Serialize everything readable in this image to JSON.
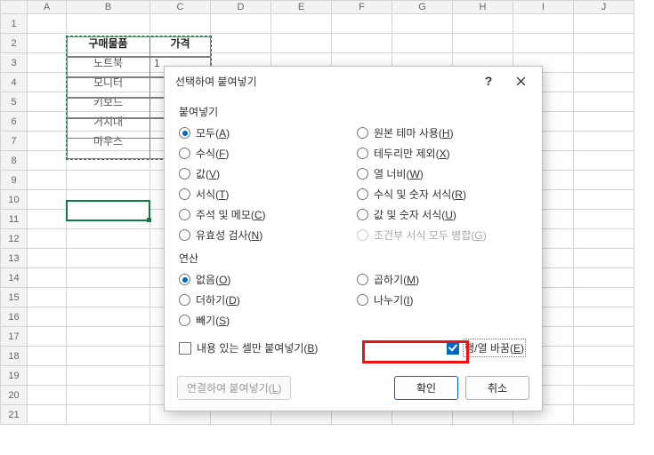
{
  "columns": [
    "A",
    "B",
    "C",
    "D",
    "E",
    "F",
    "G",
    "H",
    "I",
    "J"
  ],
  "rows": [
    "1",
    "2",
    "3",
    "4",
    "5",
    "6",
    "7",
    "8",
    "9",
    "10",
    "11",
    "12",
    "13",
    "14",
    "15",
    "16",
    "17",
    "18",
    "19",
    "20",
    "21"
  ],
  "table": {
    "header_item": "구매물품",
    "header_price": "가격",
    "items": [
      "노트북",
      "모니터",
      "키보드",
      "거치대",
      "마우스"
    ],
    "price_peek": "1"
  },
  "dialog": {
    "title": "선택하여 붙여넣기",
    "group_paste": "붙여넣기",
    "paste_left": [
      {
        "label": "모두",
        "accel": "A",
        "checked": true
      },
      {
        "label": "수식",
        "accel": "F"
      },
      {
        "label": "값",
        "accel": "V"
      },
      {
        "label": "서식",
        "accel": "T"
      },
      {
        "label": "주석 및 메모",
        "accel": "C"
      },
      {
        "label": "유효성 검사",
        "accel": "N"
      }
    ],
    "paste_right": [
      {
        "label": "원본 테마 사용",
        "accel": "H"
      },
      {
        "label": "테두리만 제외",
        "accel": "X"
      },
      {
        "label": "열 너비",
        "accel": "W"
      },
      {
        "label": "수식 및 숫자 서식",
        "accel": "R"
      },
      {
        "label": "값 및 숫자 서식",
        "accel": "U"
      },
      {
        "label": "조건부 서식 모두 병합",
        "accel": "G",
        "disabled": true
      }
    ],
    "group_op": "연산",
    "op_left": [
      {
        "label": "없음",
        "accel": "O",
        "checked": true
      },
      {
        "label": "더하기",
        "accel": "D"
      },
      {
        "label": "빼기",
        "accel": "S"
      }
    ],
    "op_right": [
      {
        "label": "곱하기",
        "accel": "M"
      },
      {
        "label": "나누기",
        "accel": "I"
      }
    ],
    "skip_blanks": {
      "label": "내용 있는 셀만 붙여넣기",
      "accel": "B"
    },
    "transpose": {
      "label": "행/열 바꿈",
      "accel": "E",
      "checked": true
    },
    "paste_link": {
      "label": "연결하여 붙여넣기",
      "accel": "L"
    },
    "ok": "확인",
    "cancel": "취소"
  }
}
